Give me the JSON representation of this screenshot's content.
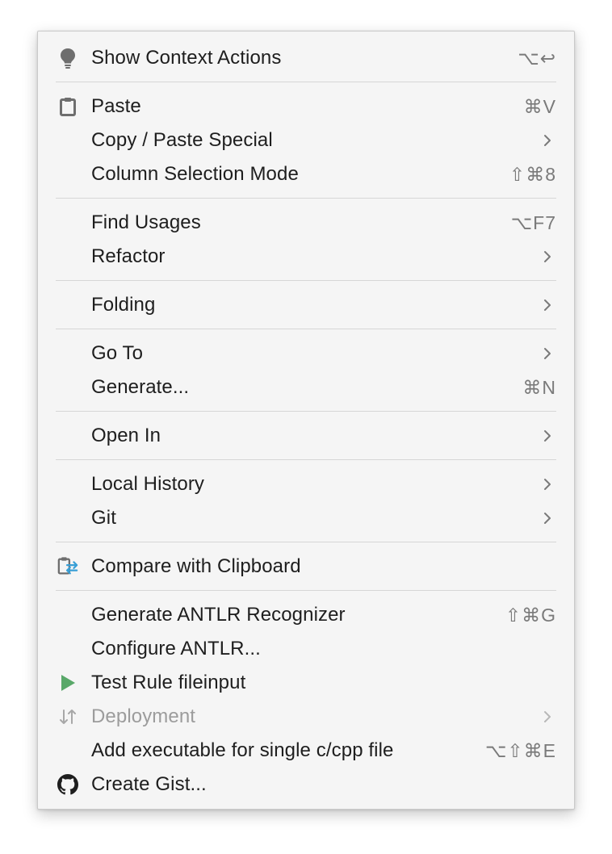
{
  "menu": {
    "show_context_actions": {
      "label": "Show Context Actions",
      "shortcut": "⌥↩"
    },
    "paste": {
      "label": "Paste",
      "shortcut": "⌘V"
    },
    "copy_paste_special": {
      "label": "Copy / Paste Special"
    },
    "column_selection_mode": {
      "label": "Column Selection Mode",
      "shortcut": "⇧⌘8"
    },
    "find_usages": {
      "label": "Find Usages",
      "shortcut": "⌥F7"
    },
    "refactor": {
      "label": "Refactor"
    },
    "folding": {
      "label": "Folding"
    },
    "go_to": {
      "label": "Go To"
    },
    "generate": {
      "label": "Generate...",
      "shortcut": "⌘N"
    },
    "open_in": {
      "label": "Open In"
    },
    "local_history": {
      "label": "Local History"
    },
    "git": {
      "label": "Git"
    },
    "compare_with_clipboard": {
      "label": "Compare with Clipboard"
    },
    "generate_antlr": {
      "label": "Generate ANTLR Recognizer",
      "shortcut": "⇧⌘G"
    },
    "configure_antlr": {
      "label": "Configure ANTLR..."
    },
    "test_rule": {
      "label": "Test Rule fileinput"
    },
    "deployment": {
      "label": "Deployment",
      "disabled": true
    },
    "add_executable": {
      "label": "Add executable for single c/cpp file",
      "shortcut": "⌥⇧⌘E"
    },
    "create_gist": {
      "label": "Create Gist..."
    }
  },
  "colors": {
    "menu_bg": "#f5f5f5",
    "text": "#1e1e1e",
    "shortcut": "#7a7a7a",
    "disabled": "#9c9c9c",
    "run_green": "#59a869",
    "compare_blue": "#389fd6"
  }
}
